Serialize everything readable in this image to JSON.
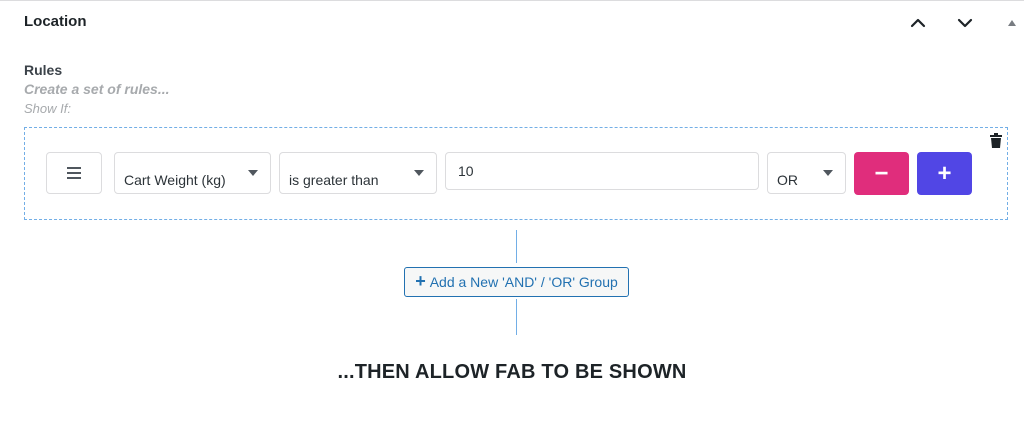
{
  "panel": {
    "title": "Location",
    "move_up_icon": "chevron-up-icon",
    "move_down_icon": "chevron-down-icon",
    "toggle_icon": "triangle-up-icon"
  },
  "rules": {
    "label": "Rules",
    "description": "Create a set of rules...",
    "show_if": "Show If:"
  },
  "rule_row": {
    "drag_icon": "menu-icon",
    "field": "Cart Weight (kg)",
    "operator": "is greater than",
    "value": "10",
    "logic": "OR",
    "remove_label": "−",
    "add_label": "+",
    "delete_icon": "trash-icon"
  },
  "add_group": {
    "plus": "+",
    "label": "Add a New 'AND' / 'OR' Group"
  },
  "then_text": "...THEN ALLOW FAB TO BE SHOWN",
  "colors": {
    "remove": "#e02d7c",
    "add": "#5146e5",
    "link": "#2271b1",
    "dashed_border": "#72aee6"
  }
}
